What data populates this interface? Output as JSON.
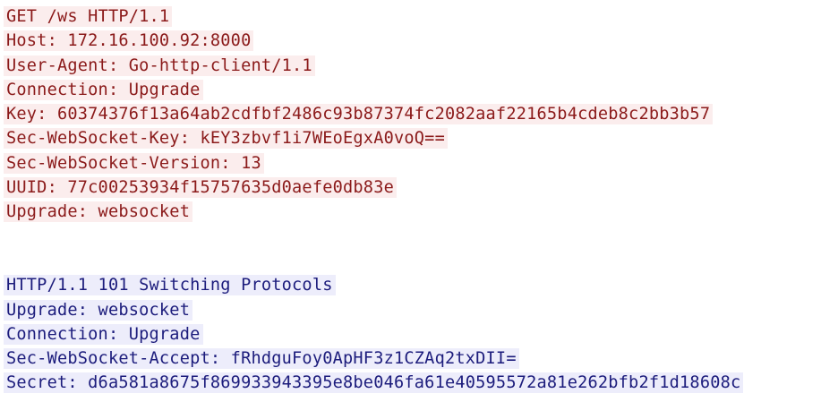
{
  "request": {
    "lines": [
      "GET /ws HTTP/1.1",
      "Host: 172.16.100.92:8000",
      "User-Agent: Go-http-client/1.1",
      "Connection: Upgrade",
      "Key: 60374376f13a64ab2cdfbf2486c93b87374fc2082aaf22165b4cdeb8c2bb3b57",
      "Sec-WebSocket-Key: kEY3zbvf1i7WEoEgxA0voQ==",
      "Sec-WebSocket-Version: 13",
      "UUID: 77c00253934f15757635d0aefe0db83e",
      "Upgrade: websocket"
    ],
    "text_color": "#8b1a1a",
    "background": "#fbeded"
  },
  "response": {
    "lines": [
      "HTTP/1.1 101 Switching Protocols",
      "Upgrade: websocket",
      "Connection: Upgrade",
      "Sec-WebSocket-Accept: fRhdguFoy0ApHF3z1CZAq2txDII=",
      "Secret: d6a581a8675f869933943395e8be046fa61e40595572a81e262bfb2f1d18608c"
    ],
    "text_color": "#1c1c7c",
    "background": "#ededfb"
  }
}
